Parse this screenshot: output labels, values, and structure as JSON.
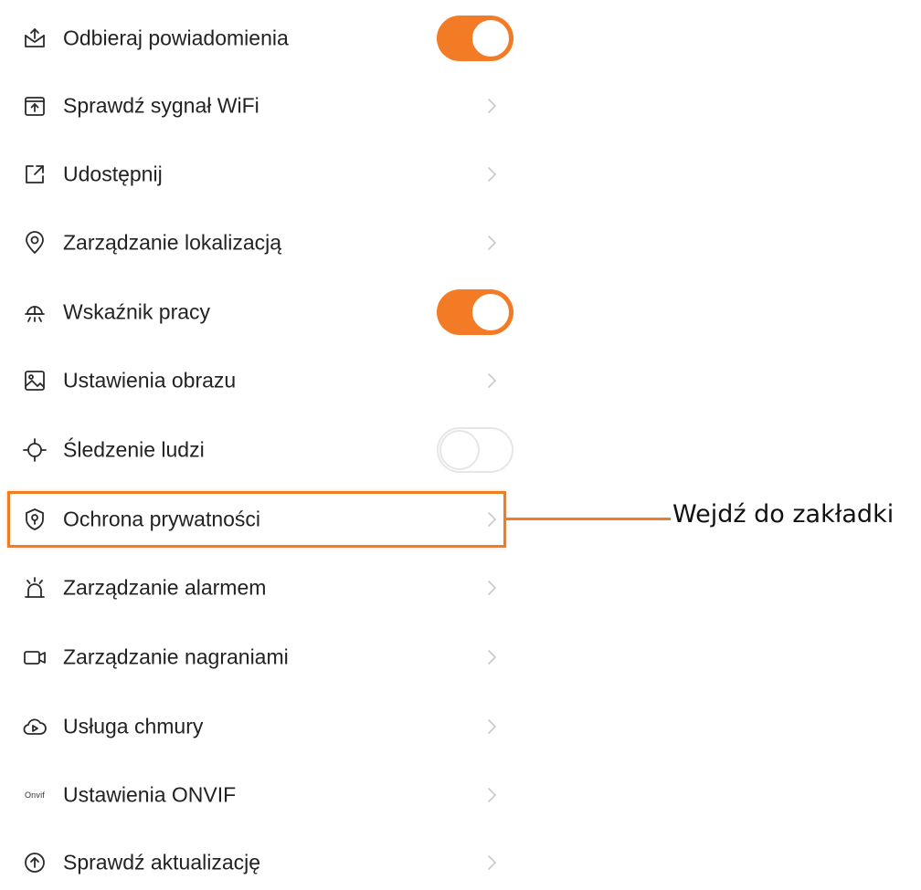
{
  "settings": {
    "items": [
      {
        "label": "Odbieraj powiadomienia",
        "icon": "notification-inbox-icon",
        "control": "toggle",
        "state": "on"
      },
      {
        "label": "Sprawdź sygnał WiFi",
        "icon": "wifi-signal-box-icon",
        "control": "chevron"
      },
      {
        "label": "Udostępnij",
        "icon": "share-icon",
        "control": "chevron"
      },
      {
        "label": "Zarządzanie lokalizacją",
        "icon": "location-pin-icon",
        "control": "chevron"
      },
      {
        "label": "Wskaźnik pracy",
        "icon": "work-indicator-lamp-icon",
        "control": "toggle",
        "state": "on"
      },
      {
        "label": "Ustawienia obrazu",
        "icon": "image-icon",
        "control": "chevron"
      },
      {
        "label": "Śledzenie ludzi",
        "icon": "crosshair-icon",
        "control": "toggle",
        "state": "off"
      },
      {
        "label": "Ochrona prywatności",
        "icon": "privacy-shield-icon",
        "control": "chevron",
        "highlighted": true
      },
      {
        "label": "Zarządzanie alarmem",
        "icon": "alarm-siren-icon",
        "control": "chevron"
      },
      {
        "label": "Zarządzanie nagraniami",
        "icon": "video-camera-icon",
        "control": "chevron"
      },
      {
        "label": "Usługa chmury",
        "icon": "cloud-play-icon",
        "control": "chevron"
      },
      {
        "label": "Ustawienia ONVIF",
        "icon": "onvif-logo-icon",
        "icon_text": "Onvif",
        "control": "chevron"
      },
      {
        "label": "Sprawdź aktualizację",
        "icon": "update-arrow-circle-icon",
        "control": "chevron"
      }
    ]
  },
  "annotation": {
    "text": "Wejdź do zakładki"
  },
  "colors": {
    "accent": "#f47b25",
    "highlight_border": "#ee7d23",
    "text": "#222222",
    "chevron": "#c8c8c8",
    "toggle_off_border": "#e6e6e6"
  }
}
